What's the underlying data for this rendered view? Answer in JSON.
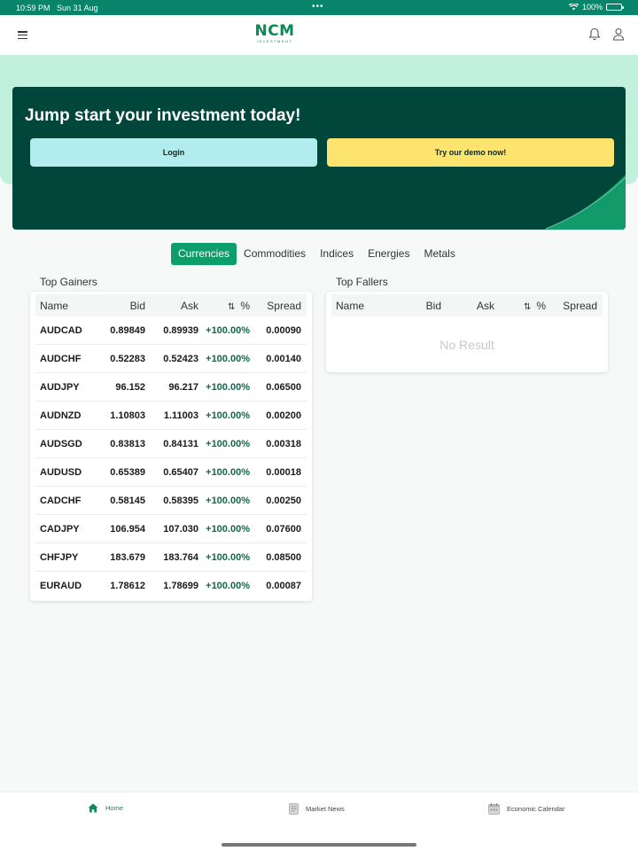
{
  "status": {
    "time": "10:59 PM",
    "date": "Sun 31 Aug",
    "battery": "100%"
  },
  "appbar": {
    "logo_text": "NCM",
    "logo_sub": "INVESTMENT"
  },
  "hero": {
    "title": "Jump start your investment today!",
    "login_label": "Login",
    "demo_label": "Try our demo now!"
  },
  "tabs": [
    {
      "label": "Currencies",
      "active": true
    },
    {
      "label": "Commodities",
      "active": false
    },
    {
      "label": "Indices",
      "active": false
    },
    {
      "label": "Energies",
      "active": false
    },
    {
      "label": "Metals",
      "active": false
    }
  ],
  "columns": {
    "name": "Name",
    "bid": "Bid",
    "ask": "Ask",
    "sort_icon": "⇅",
    "pct": "%",
    "spread": "Spread"
  },
  "gainers": {
    "title": "Top Gainers",
    "rows": [
      {
        "name": "AUDCAD",
        "bid": "0.89849",
        "ask": "0.89939",
        "pct": "+100.00%",
        "spread": "0.00090"
      },
      {
        "name": "AUDCHF",
        "bid": "0.52283",
        "ask": "0.52423",
        "pct": "+100.00%",
        "spread": "0.00140"
      },
      {
        "name": "AUDJPY",
        "bid": "96.152",
        "ask": "96.217",
        "pct": "+100.00%",
        "spread": "0.06500"
      },
      {
        "name": "AUDNZD",
        "bid": "1.10803",
        "ask": "1.11003",
        "pct": "+100.00%",
        "spread": "0.00200"
      },
      {
        "name": "AUDSGD",
        "bid": "0.83813",
        "ask": "0.84131",
        "pct": "+100.00%",
        "spread": "0.00318"
      },
      {
        "name": "AUDUSD",
        "bid": "0.65389",
        "ask": "0.65407",
        "pct": "+100.00%",
        "spread": "0.00018"
      },
      {
        "name": "CADCHF",
        "bid": "0.58145",
        "ask": "0.58395",
        "pct": "+100.00%",
        "spread": "0.00250"
      },
      {
        "name": "CADJPY",
        "bid": "106.954",
        "ask": "107.030",
        "pct": "+100.00%",
        "spread": "0.07600"
      },
      {
        "name": "CHFJPY",
        "bid": "183.679",
        "ask": "183.764",
        "pct": "+100.00%",
        "spread": "0.08500"
      },
      {
        "name": "EURAUD",
        "bid": "1.78612",
        "ask": "1.78699",
        "pct": "+100.00%",
        "spread": "0.00087"
      }
    ]
  },
  "fallers": {
    "title": "Top Fallers",
    "empty_text": "No Result"
  },
  "nav": [
    {
      "label": "Home",
      "icon": "home-icon",
      "active": true
    },
    {
      "label": "Market News",
      "icon": "news-icon",
      "active": false
    },
    {
      "label": "Economic Calendar",
      "icon": "calendar-icon",
      "active": false
    }
  ],
  "colors": {
    "brand": "#07846a",
    "hero": "#00463a",
    "accent": "#0e9e6c",
    "login": "#b3ecee",
    "demo": "#fce46f",
    "positive": "#0a6b45"
  }
}
